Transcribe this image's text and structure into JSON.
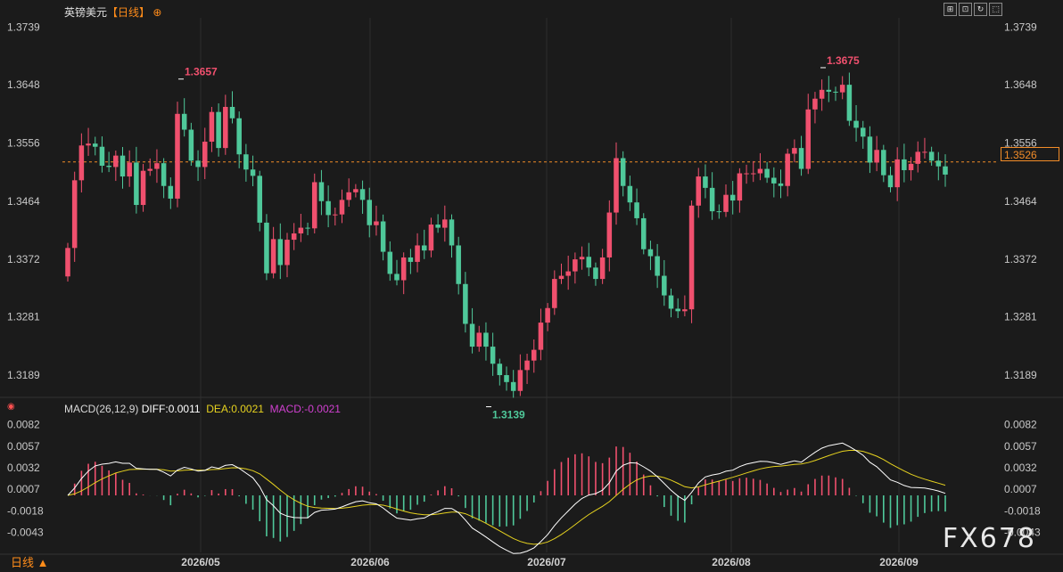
{
  "header": {
    "symbol": "英镑美元",
    "period": "【日线】",
    "add_icon": "circle-plus-icon"
  },
  "toolbar": {
    "buttons": [
      {
        "name": "crosshair-button",
        "glyph": "⊞"
      },
      {
        "name": "fit-button",
        "glyph": "⊡"
      },
      {
        "name": "reset-button",
        "glyph": "↻"
      },
      {
        "name": "fullscreen-button",
        "glyph": "⬚"
      }
    ]
  },
  "indicator": {
    "title": "MACD(26,12,9)",
    "diff_label": "DIFF:0.0011",
    "dea_label": "DEA:0.0021",
    "macd_label": "MACD:-0.0021",
    "diff_color": "#ffffff",
    "dea_color": "#e6d21f",
    "macd_color": "#d040d0"
  },
  "footer": {
    "period_label": "日线 ▲",
    "watermark": "FX678"
  },
  "current_price": "1.3526",
  "colors": {
    "up": "#f0506e",
    "down": "#4fc89a",
    "background": "#1b1b1b",
    "current_line": "#f28c28"
  },
  "chart_data": [
    {
      "type": "candlestick",
      "title": "英镑美元【日线】",
      "x_ticks": [
        "2026/05",
        "2026/06",
        "2026/07",
        "2026/08",
        "2026/09"
      ],
      "y_ticks": [
        "1.3739",
        "1.3648",
        "1.3556",
        "1.3464",
        "1.3372",
        "1.3281",
        "1.3189"
      ],
      "ylim": [
        1.3151,
        1.3751
      ],
      "annotations": [
        {
          "text": "1.3657",
          "value": 1.3657,
          "kind": "high"
        },
        {
          "text": "1.3675",
          "value": 1.3675,
          "kind": "high"
        },
        {
          "text": "1.3139",
          "value": 1.3139,
          "kind": "low"
        }
      ],
      "current_price": 1.3526,
      "ohlc_close_path": [
        1.339,
        1.3497,
        1.3552,
        1.3555,
        1.355,
        1.352,
        1.3518,
        1.3536,
        1.3503,
        1.3525,
        1.3458,
        1.3512,
        1.3515,
        1.3524,
        1.3488,
        1.3468,
        1.3602,
        1.3577,
        1.3528,
        1.3518,
        1.3558,
        1.3605,
        1.3548,
        1.3613,
        1.3595,
        1.3538,
        1.3514,
        1.3504,
        1.343,
        1.335,
        1.3404,
        1.3363,
        1.3403,
        1.3413,
        1.3422,
        1.3421,
        1.3494,
        1.3464,
        1.3442,
        1.3443,
        1.3466,
        1.3478,
        1.3483,
        1.3466,
        1.3426,
        1.3432,
        1.3384,
        1.3349,
        1.3339,
        1.3375,
        1.3368,
        1.3394,
        1.3386,
        1.3427,
        1.3422,
        1.3435,
        1.3394,
        1.3333,
        1.327,
        1.3234,
        1.3256,
        1.3234,
        1.3207,
        1.3189,
        1.3178,
        1.3164,
        1.3197,
        1.3212,
        1.3229,
        1.3272,
        1.3295,
        1.3341,
        1.3346,
        1.3353,
        1.3372,
        1.3376,
        1.3359,
        1.3341,
        1.3375,
        1.3446,
        1.3532,
        1.3488,
        1.3462,
        1.3437,
        1.3388,
        1.3377,
        1.3346,
        1.3315,
        1.3294,
        1.329,
        1.3293,
        1.3457,
        1.3503,
        1.3485,
        1.3448,
        1.3447,
        1.3474,
        1.3465,
        1.3508,
        1.3508,
        1.3508,
        1.3515,
        1.3501,
        1.3492,
        1.3488,
        1.3539,
        1.3548,
        1.3515,
        1.3609,
        1.3626,
        1.364,
        1.3637,
        1.3636,
        1.3648,
        1.3591,
        1.358,
        1.3566,
        1.3525,
        1.3545,
        1.3505,
        1.3486,
        1.353,
        1.3513,
        1.3523,
        1.3542,
        1.3542,
        1.3528,
        1.3519,
        1.3506
      ]
    },
    {
      "type": "bar+line",
      "title": "MACD(26,12,9)",
      "y_ticks": [
        "0.0082",
        "0.0057",
        "0.0032",
        "0.0007",
        "-0.0018",
        "-0.0043"
      ],
      "ylim": [
        -0.0064,
        0.0097
      ],
      "series": [
        {
          "name": "DIFF",
          "last": 0.0011
        },
        {
          "name": "DEA",
          "last": 0.0021
        },
        {
          "name": "MACD",
          "last": -0.0021
        }
      ]
    }
  ]
}
